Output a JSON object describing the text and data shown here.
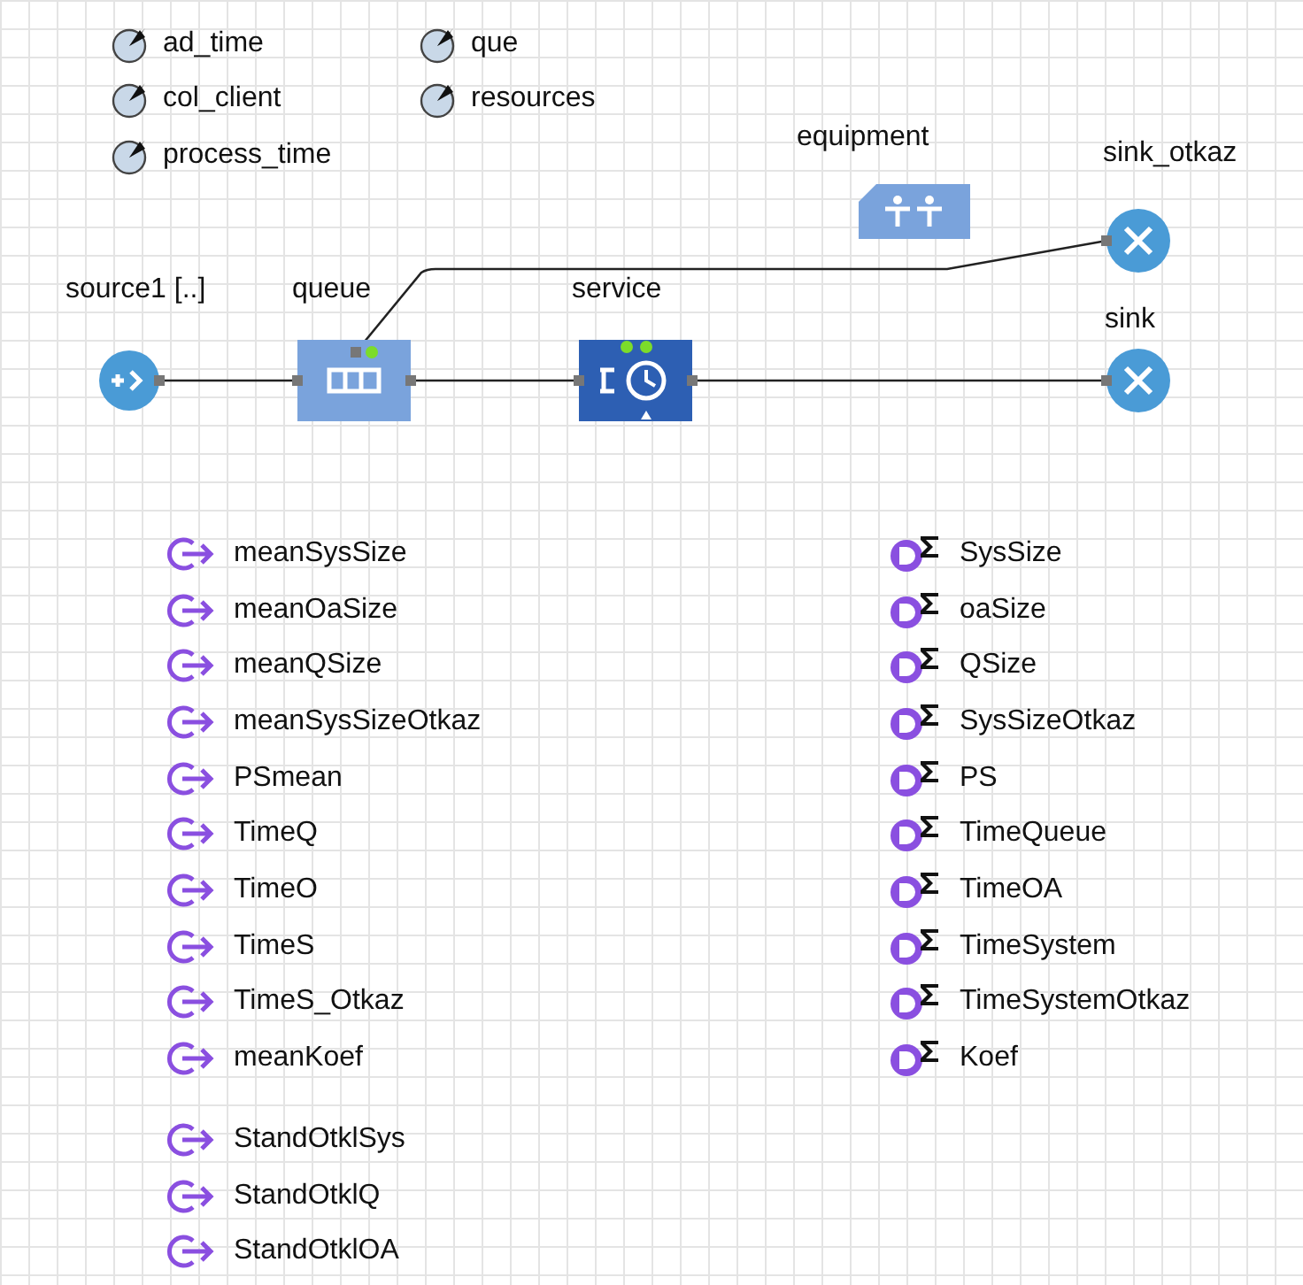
{
  "parameters": [
    {
      "name": "ad_time"
    },
    {
      "name": "col_client"
    },
    {
      "name": "process_time"
    },
    {
      "name": "que"
    },
    {
      "name": "resources"
    }
  ],
  "flowchart": {
    "blocks": [
      {
        "kind": "resource_pool",
        "label": "equipment"
      },
      {
        "kind": "sink",
        "label": "sink_otkaz"
      },
      {
        "kind": "source",
        "label": "source1 [..]"
      },
      {
        "kind": "queue",
        "label": "queue"
      },
      {
        "kind": "service",
        "label": "service"
      },
      {
        "kind": "sink",
        "label": "sink"
      }
    ]
  },
  "functions": [
    {
      "name": "meanSysSize"
    },
    {
      "name": "meanOaSize"
    },
    {
      "name": "meanQSize"
    },
    {
      "name": "meanSysSizeOtkaz"
    },
    {
      "name": "PSmean"
    },
    {
      "name": "TimeQ"
    },
    {
      "name": "TimeO"
    },
    {
      "name": "TimeS"
    },
    {
      "name": "TimeS_Otkaz"
    },
    {
      "name": "meanKoef"
    }
  ],
  "functions_2": [
    {
      "name": "StandOtklSys"
    },
    {
      "name": "StandOtklQ"
    },
    {
      "name": "StandOtklOA"
    }
  ],
  "datasets": [
    {
      "name": "SysSize"
    },
    {
      "name": "oaSize"
    },
    {
      "name": "QSize"
    },
    {
      "name": "SysSizeOtkaz"
    },
    {
      "name": "PS"
    },
    {
      "name": "TimeQueue"
    },
    {
      "name": "TimeOA"
    },
    {
      "name": "TimeSystem"
    },
    {
      "name": "TimeSystemOtkaz"
    },
    {
      "name": "Koef"
    }
  ]
}
